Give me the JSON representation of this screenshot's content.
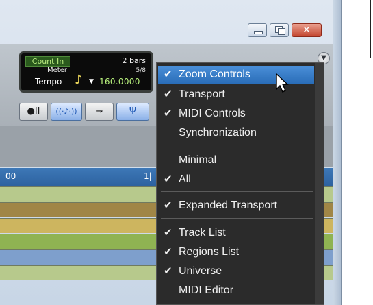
{
  "window": {
    "minimize_icon": "minimize-icon",
    "restore_icon": "restore-icon",
    "close_icon": "close-icon"
  },
  "counter": {
    "count_in_label": "Count In",
    "count_in_value": "2 bars",
    "meter_label": "Meter",
    "meter_value": "5/8",
    "tempo_label": "Tempo",
    "tempo_note_icon": "quarter-note-icon",
    "tempo_value": "160.0000"
  },
  "toolbar": {
    "buttons": [
      {
        "icon": "record-pause-icon",
        "glyph": "●II"
      },
      {
        "icon": "audio-wave-icon",
        "glyph": "((·♪·))"
      },
      {
        "icon": "step-arrow-icon",
        "glyph": "⇁"
      },
      {
        "icon": "antenna-icon",
        "glyph": "Ψ"
      }
    ],
    "menu_button_icon": "chevron-down-icon"
  },
  "timeline": {
    "ruler_left": "00",
    "ruler_right": "1|",
    "tracks": [
      {
        "color": "#b7c98c"
      },
      {
        "color": "#a08646"
      },
      {
        "color": "#cdb55f"
      },
      {
        "color": "#8fb352"
      },
      {
        "color": "#7e9fcc"
      },
      {
        "color": "#b7c98c"
      }
    ]
  },
  "menu": {
    "items": [
      {
        "label": "Zoom Controls",
        "checked": "✔",
        "highlighted": true
      },
      {
        "label": "Transport",
        "checked": "✔"
      },
      {
        "label": "MIDI Controls",
        "checked": "✔"
      },
      {
        "label": "Synchronization",
        "checked": ""
      },
      {
        "label": "Minimal",
        "checked": ""
      },
      {
        "label": "All",
        "checked": "✔"
      },
      {
        "label": "Expanded Transport",
        "checked": "✔"
      },
      {
        "label": "Track List",
        "checked": "✔"
      },
      {
        "label": "Regions List",
        "checked": "✔"
      },
      {
        "label": "Universe",
        "checked": "✔"
      },
      {
        "label": "MIDI Editor",
        "checked": ""
      }
    ]
  },
  "colors": {
    "menu_bg": "#2b2b2b",
    "highlight": "#3a80cc",
    "ruler": "#3570ae",
    "playhead": "#e02020"
  }
}
